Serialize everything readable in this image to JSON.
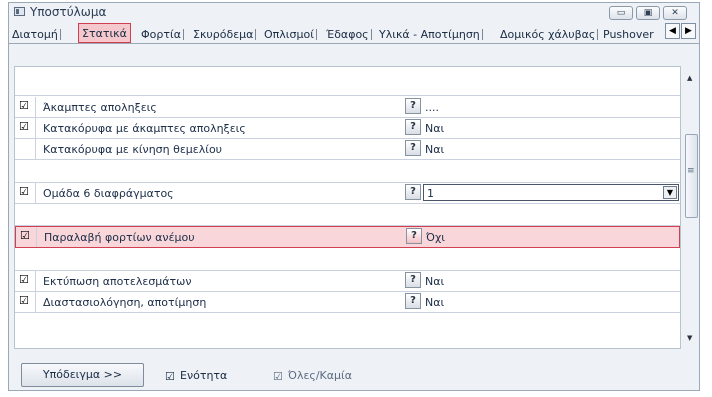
{
  "window": {
    "title": "Υποστύλωμα",
    "buttons": {
      "minimize": "▭",
      "maximize": "▣",
      "close": "✕"
    }
  },
  "tabs": [
    {
      "label": "Διατομή"
    },
    {
      "label": "Στατικά",
      "active": true
    },
    {
      "label": "Φορτία"
    },
    {
      "label": "Σκυρόδεμα"
    },
    {
      "label": "Οπλισμοί"
    },
    {
      "label": "Έδαφος"
    },
    {
      "label": "Υλικά - Αποτίμηση"
    },
    {
      "label": "Δομικός χάλυβας"
    },
    {
      "label": "Pushover"
    }
  ],
  "tab_arrows": {
    "left": "◀",
    "right": "▶"
  },
  "rows": [
    {
      "checked": true,
      "check_glyph": "☑",
      "label": "Άκαμπτες αποληξεις",
      "help": "?",
      "value": "...."
    },
    {
      "checked": true,
      "check_glyph": "☑",
      "label": "Κατακόρυφα με άκαμπτες αποληξεις",
      "help": "?",
      "value": "Ναι"
    },
    {
      "checked": false,
      "check_glyph": "",
      "label": "Κατακόρυφα με κίνηση θεμελίου",
      "help": "?",
      "value": "Ναι"
    },
    {
      "checked": true,
      "check_glyph": "☑",
      "label": "Ομάδα 6 διαφράγματος",
      "help": "?",
      "value": "1",
      "combo": true,
      "combo_arrow": "▼"
    },
    {
      "checked": true,
      "check_glyph": "☑",
      "label": "Παραλαβή φορτίων ανέμου",
      "help": "?",
      "value": "Όχι",
      "highlighted": true
    },
    {
      "checked": true,
      "check_glyph": "☑",
      "label": "Εκτύπωση αποτελεσμάτων",
      "help": "?",
      "value": "Ναι"
    },
    {
      "checked": true,
      "check_glyph": "☑",
      "label": "Διαστασιολόγηση, αποτίμηση",
      "help": "?",
      "value": "Ναι"
    }
  ],
  "scrollbar": {
    "up": "▲",
    "down": "▼",
    "grip": "≡"
  },
  "footer": {
    "sample_button": "Υπόδειγμα >>",
    "unit_checkbox": {
      "label": "Ενότητα",
      "checked": true,
      "glyph": "☑"
    },
    "all_none_checkbox": {
      "label": "Όλες/Καμία",
      "checked": true,
      "glyph": "☑"
    }
  }
}
